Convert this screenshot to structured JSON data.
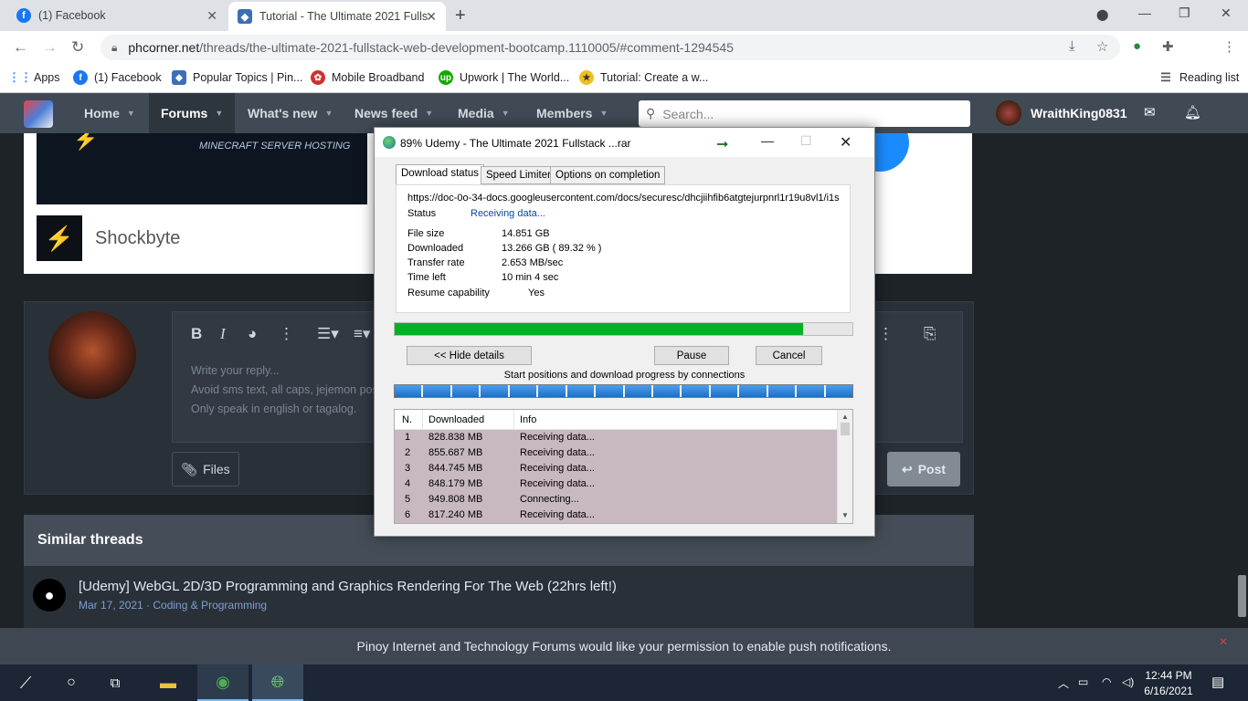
{
  "browser": {
    "tabs": [
      {
        "title": "(1) Facebook"
      },
      {
        "title": "Tutorial - The Ultimate 2021 Fullst"
      }
    ],
    "address": {
      "domain": "phcorner.net",
      "path": "/threads/the-ultimate-2021-fullstack-web-development-bootcamp.1110005/#comment-1294545"
    },
    "bookmarks": [
      "Apps",
      "(1) Facebook",
      "Popular Topics | Pin...",
      "Mobile Broadband",
      "Upwork | The World...",
      "Tutorial: Create a w..."
    ],
    "reading_list": "Reading list"
  },
  "site": {
    "nav": [
      "Home",
      "Forums",
      "What's new",
      "News feed",
      "Media",
      "Members"
    ],
    "search_placeholder": "Search...",
    "username": "WraithKing0831",
    "ad": {
      "banner_text": "MINECRAFT SERVER HOSTING",
      "name": "Shockbyte"
    },
    "reply": {
      "placeholder_lines": [
        "Write your reply...",
        "Avoid sms text, all caps, jejemon posts",
        "Only speak in english or tagalog."
      ],
      "files_label": "Files",
      "post_label": "Post"
    },
    "similar": {
      "heading": "Similar threads",
      "thread_title": "[Udemy] WebGL 2D/3D Programming and Graphics Rendering For The Web (22hrs left!)",
      "thread_meta": "Mar 17, 2021 · Coding & Programming"
    },
    "push_notice": "Pinoy Internet and Technology Forums would like your permission to enable push notifications."
  },
  "dialog": {
    "title": "89% Udemy - The Ultimate 2021 Fullstack ...rar",
    "tabs": [
      "Download status",
      "Speed Limiter",
      "Options on completion"
    ],
    "url": "https://doc-0o-34-docs.googleusercontent.com/docs/securesc/dhcjiihfib6atgtejurpnrl1r19u8vl1/i1s",
    "status_label": "Status",
    "status_value": "Receiving data...",
    "file_size_label": "File size",
    "file_size_value": "14.851  GB",
    "downloaded_label": "Downloaded",
    "downloaded_value": "13.266  GB  ( 89.32 % )",
    "transfer_label": "Transfer rate",
    "transfer_value": "2.653  MB/sec",
    "time_left_label": "Time left",
    "time_left_value": "10 min 4 sec",
    "resume_label": "Resume capability",
    "resume_value": "Yes",
    "progress_percent": 89.32,
    "hide_details": "<< Hide details",
    "pause": "Pause",
    "cancel": "Cancel",
    "connections_caption": "Start positions and download progress by connections",
    "table_headers": [
      "N.",
      "Downloaded",
      "Info"
    ],
    "rows": [
      {
        "n": "1",
        "downloaded": "828.838  MB",
        "info": "Receiving data..."
      },
      {
        "n": "2",
        "downloaded": "855.687  MB",
        "info": "Receiving data..."
      },
      {
        "n": "3",
        "downloaded": "844.745  MB",
        "info": "Receiving data..."
      },
      {
        "n": "4",
        "downloaded": "848.179  MB",
        "info": "Receiving data..."
      },
      {
        "n": "5",
        "downloaded": "949.808  MB",
        "info": "Connecting..."
      },
      {
        "n": "6",
        "downloaded": "817.240  MB",
        "info": "Receiving data..."
      }
    ]
  },
  "taskbar": {
    "time": "12:44 PM",
    "date": "6/16/2021"
  },
  "colors": {
    "accent_green": "#06b025",
    "site_nav": "#404a55"
  }
}
